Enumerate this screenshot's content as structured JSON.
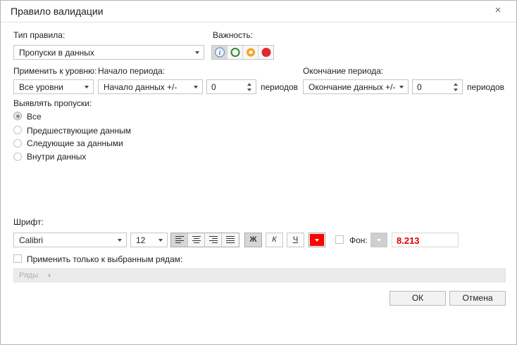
{
  "dialog": {
    "title": "Правило валидации",
    "close_glyph": "×"
  },
  "rule_type": {
    "label": "Тип правила:",
    "value": "Пропуски в данных"
  },
  "importance": {
    "label": "Важность:",
    "buttons": [
      {
        "name": "info-icon",
        "color": "#6a9fd8",
        "active": true
      },
      {
        "name": "green-circle-icon",
        "color": "#2e8b2e",
        "active": false
      },
      {
        "name": "orange-circle-icon",
        "color": "#f5a623",
        "active": false
      },
      {
        "name": "red-circle-icon",
        "color": "#e0282d",
        "active": false
      }
    ]
  },
  "level": {
    "label": "Применить к уровню:",
    "value": "Все уровни"
  },
  "period_start": {
    "label": "Начало периода:",
    "value": "Начало данных +/-",
    "offset": "0",
    "unit": "периодов"
  },
  "period_end": {
    "label": "Окончание периода:",
    "value": "Окончание данных +/-",
    "offset": "0",
    "unit": "периодов"
  },
  "detect": {
    "label": "Выявлять пропуски:",
    "options": [
      "Все",
      "Предшествующие данным",
      "Следующие за данными",
      "Внутри данных"
    ],
    "selected_index": 0
  },
  "font": {
    "label": "Шрифт:",
    "family": "Calibri",
    "size": "12",
    "bold_label": "Ж",
    "italic_label": "К",
    "underline_label": "Ч",
    "font_color": "#ff0000",
    "background_label": "Фон:",
    "preview_text": "8.213",
    "preview_color": "#e00000"
  },
  "apply_rows": {
    "label": "Применить только к выбранным рядам:",
    "placeholder": "Ряды"
  },
  "buttons": {
    "ok": "ОК",
    "cancel": "Отмена"
  }
}
